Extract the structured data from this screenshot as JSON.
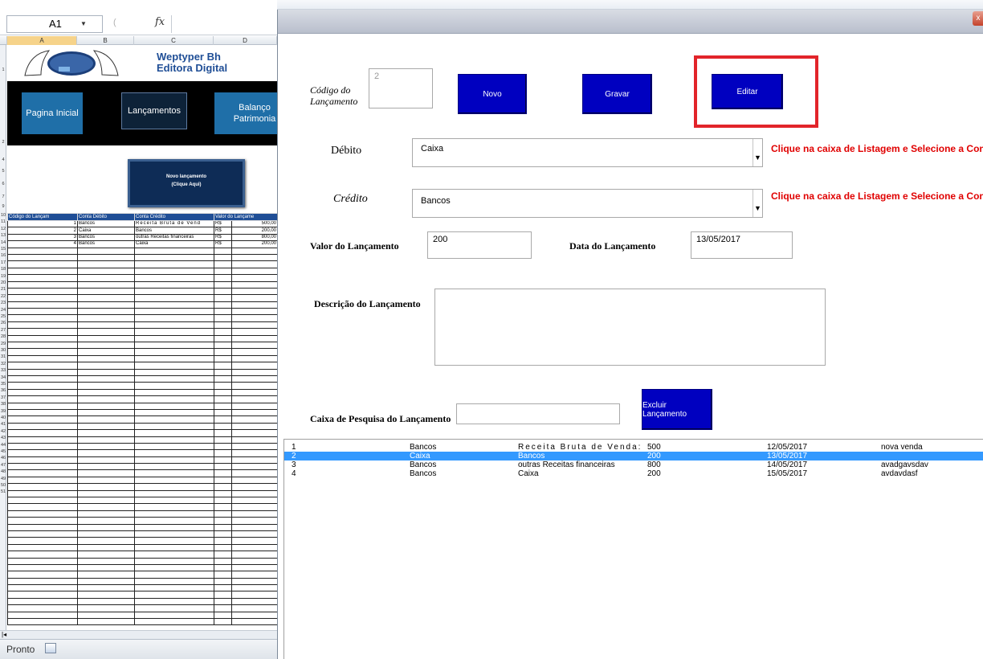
{
  "excel": {
    "namebox": "A1",
    "fx": "fx",
    "columns": [
      "A",
      "B",
      "C",
      "D"
    ],
    "brand_line1": "Weptyper Bh",
    "brand_line2": "Editora Digital",
    "nav": {
      "home": "Pagina Inicial",
      "lancamentos": "Lançamentos",
      "balanco_line1": "Balanço",
      "balanco_line2": "Patrimonia"
    },
    "novo_lancamento_line1": "Novo lançamento",
    "novo_lancamento_line2": "(Clique Aqui)",
    "table": {
      "headers": [
        "Código do Lançam",
        "Conta Débito",
        "Conta Crédito",
        "Valor do Lançame"
      ],
      "rows": [
        [
          "1",
          "Bancos",
          "Receita Bruta de Vend",
          "R$",
          "500,00"
        ],
        [
          "2",
          "Caixa",
          "Bancos",
          "R$",
          "200,00"
        ],
        [
          "3",
          "Bancos",
          "outras Receitas financeiras",
          "R$",
          "800,00"
        ],
        [
          "4",
          "Bancos",
          "Caixa",
          "R$",
          "200,00"
        ]
      ],
      "row_numbers": [
        "10",
        "11",
        "12",
        "13",
        "14",
        "15",
        "16",
        "17",
        "18",
        "19",
        "20",
        "21",
        "22",
        "23",
        "24",
        "25",
        "26",
        "27",
        "28",
        "29",
        "30",
        "31",
        "32",
        "33",
        "34",
        "35",
        "36",
        "37",
        "38",
        "39",
        "40",
        "41",
        "42",
        "43",
        "44",
        "45",
        "46",
        "47",
        "48",
        "49",
        "50",
        "51"
      ]
    },
    "status": "Pronto"
  },
  "form": {
    "codigo_label_line1": "Código do",
    "codigo_label_line2": "Lançamento",
    "codigo_value": "2",
    "buttons": {
      "novo": "Novo",
      "gravar": "Gravar",
      "editar": "Editar",
      "excluir": "Excluir Lançamento"
    },
    "debito_label": "Débito",
    "debito_value": "Caixa",
    "credito_label": "Crédito",
    "credito_value": "Bancos",
    "hint_text": "Clique na caixa de Listagem e Selecione a Conta.",
    "valor_label": "Valor do Lançamento",
    "valor_value": "200",
    "data_label": "Data do Lançamento",
    "data_value": "13/05/2017",
    "descricao_label": "Descrição do Lançamento",
    "descricao_value": "",
    "pesquisa_label": "Caixa de Pesquisa  do Lançamento",
    "pesquisa_value": "",
    "list": [
      {
        "id": "1",
        "debito": "Bancos",
        "credito": "Receita Bruta de Venda:",
        "valor": "500",
        "data": "12/05/2017",
        "desc": "nova venda",
        "selected": false
      },
      {
        "id": "2",
        "debito": "Caixa",
        "credito": "Bancos",
        "valor": "200",
        "data": "13/05/2017",
        "desc": "",
        "selected": true
      },
      {
        "id": "3",
        "debito": "Bancos",
        "credito": "outras Receitas  financeiras",
        "valor": "800",
        "data": "14/05/2017",
        "desc": "avadgavsdav",
        "selected": false
      },
      {
        "id": "4",
        "debito": "Bancos",
        "credito": "Caixa",
        "valor": "200",
        "data": "15/05/2017",
        "desc": "avdavdasf",
        "selected": false
      }
    ],
    "colors": {
      "button_blue": "#0000c0",
      "hint_red": "#e00000",
      "highlight_red": "#e2242a",
      "selection_blue": "#3399ff"
    }
  }
}
